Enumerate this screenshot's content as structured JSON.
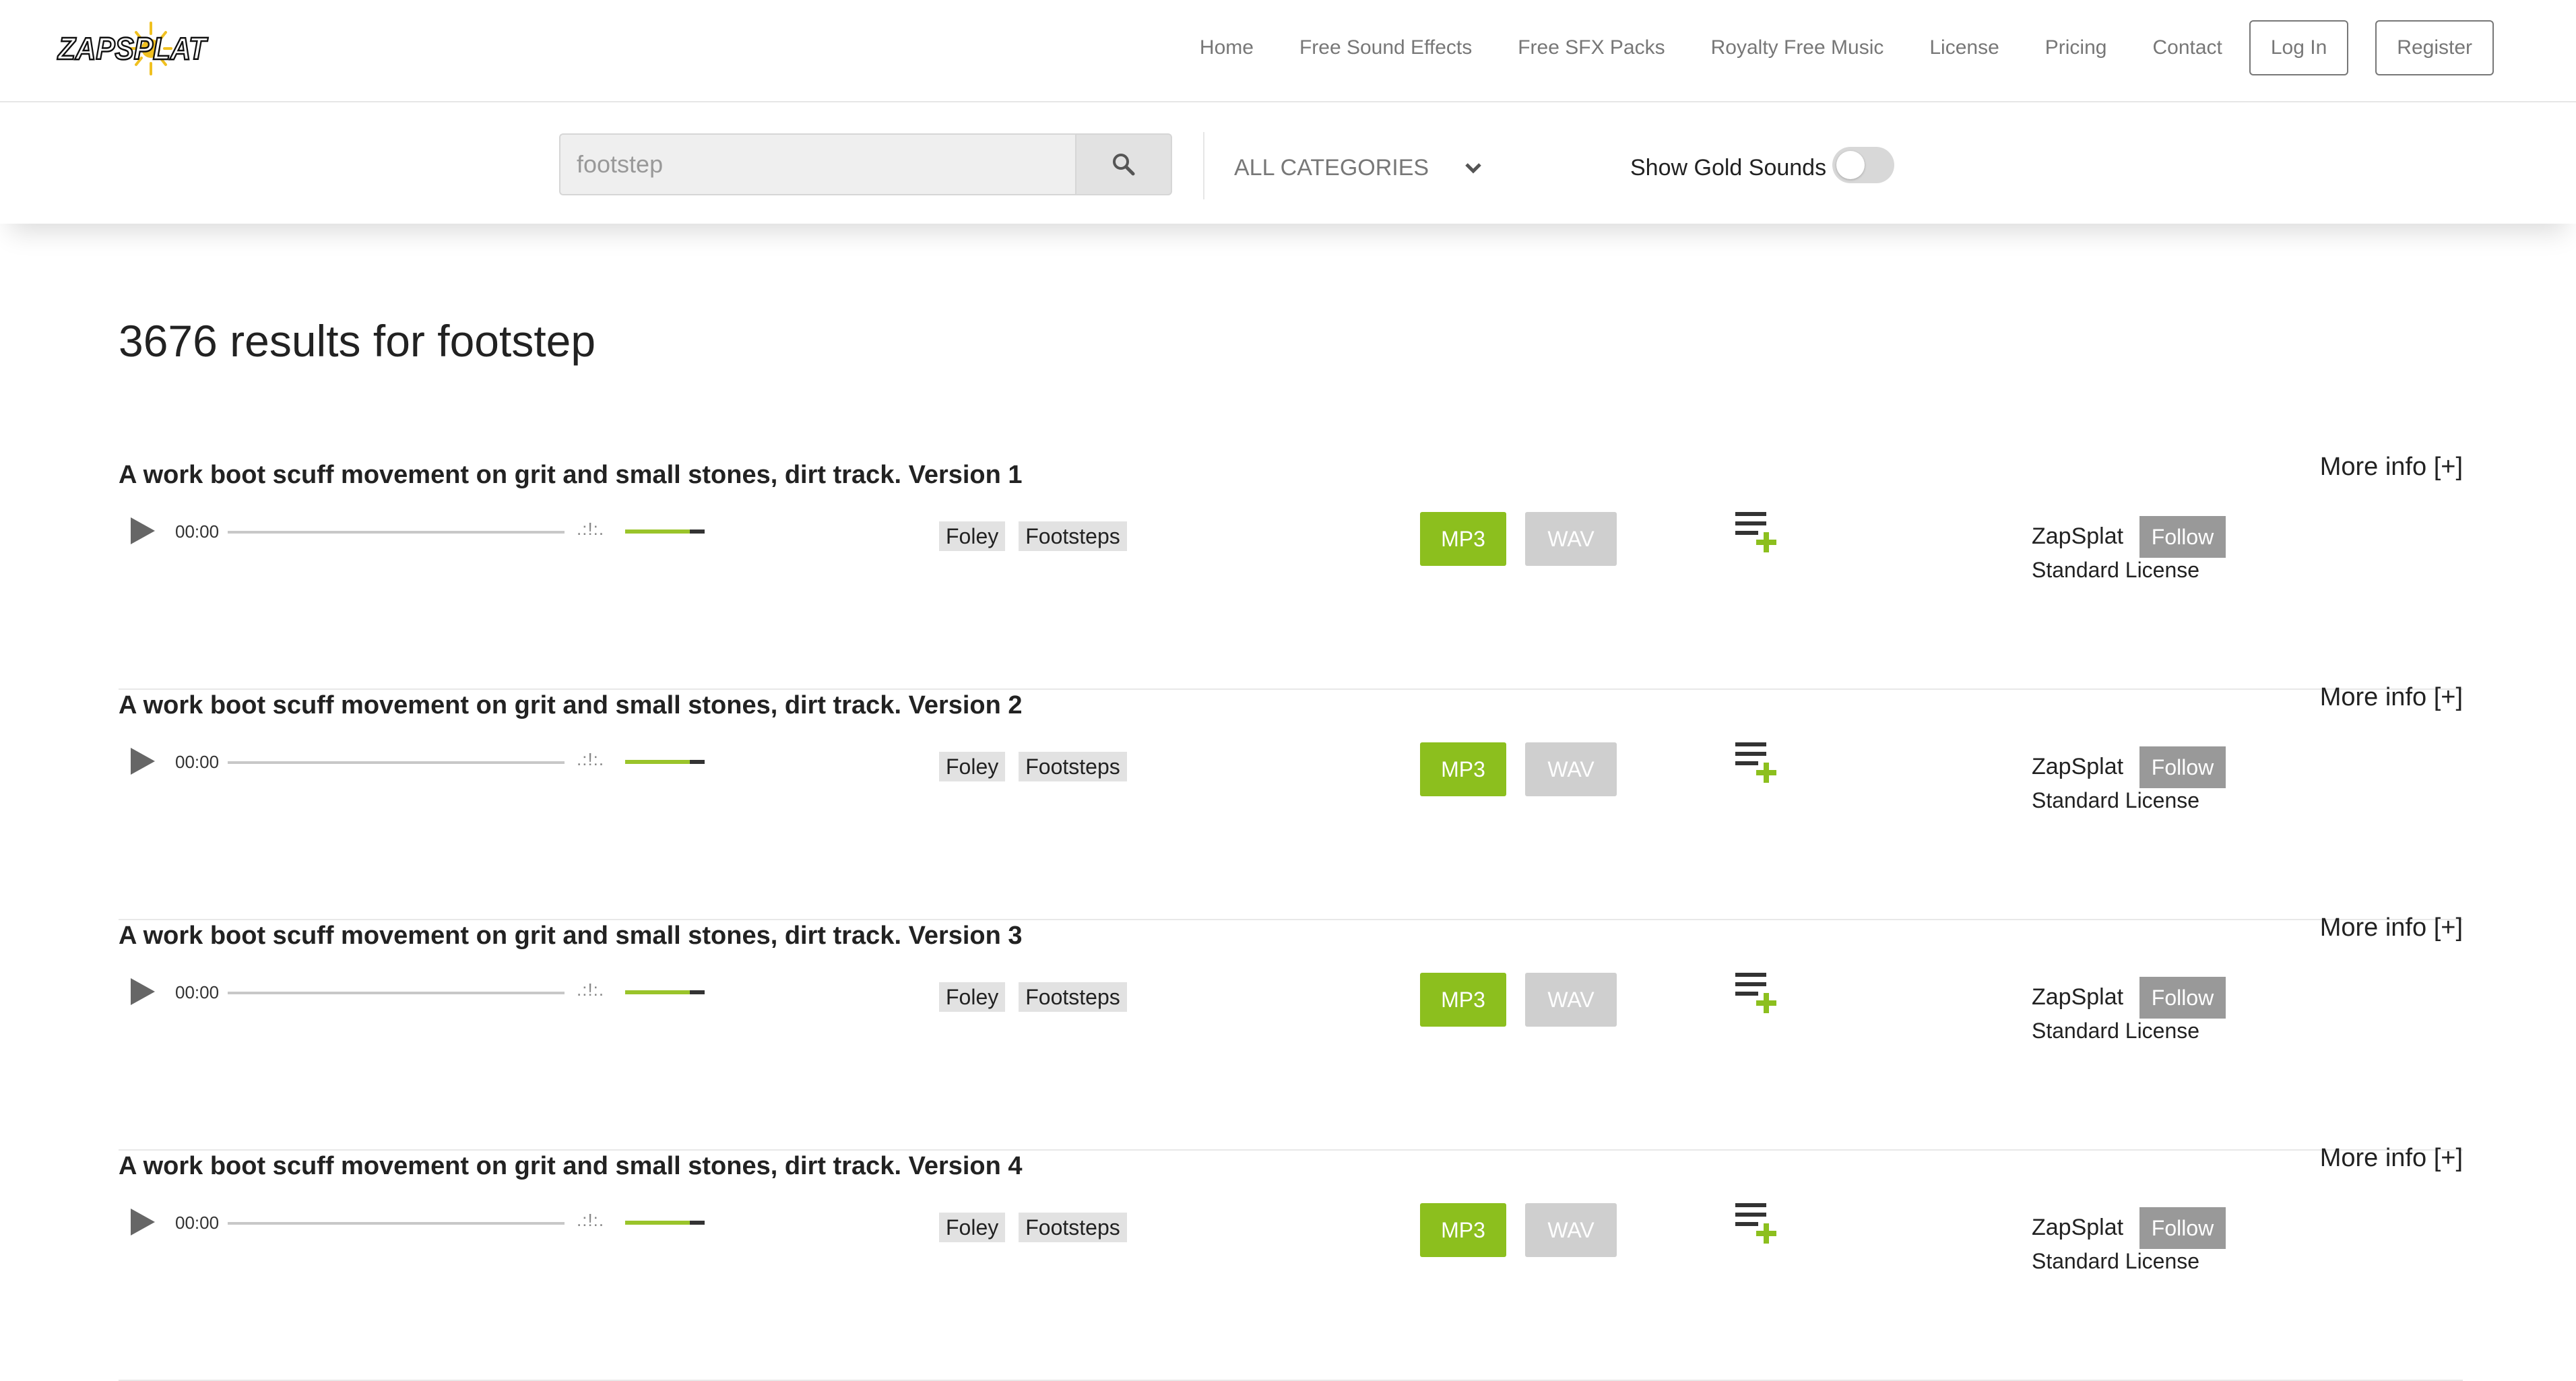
{
  "brand": {
    "logo_text": "ZAPSPLAT",
    "accent": "#8cbf1e",
    "logo_sun": "#f0c020"
  },
  "nav": {
    "links": [
      "Home",
      "Free Sound Effects",
      "Free SFX Packs",
      "Royalty Free Music",
      "License",
      "Pricing",
      "Contact"
    ],
    "login_label": "Log In",
    "register_label": "Register"
  },
  "search": {
    "query": "footstep",
    "button_icon": "search-icon",
    "category": "ALL CATEGORIES",
    "gold_label": "Show Gold Sounds",
    "gold_enabled": false
  },
  "results": {
    "summary": "3676 results for footstep",
    "items": [
      {
        "title": "A work boot scuff movement on grit and small stones, dirt track. Version 1",
        "time": "00:00",
        "tags": [
          "Foley",
          "Footsteps"
        ],
        "mp3": "MP3",
        "wav": "WAV",
        "author": "ZapSplat",
        "follow": "Follow",
        "license": "Standard License",
        "more": "More info [+]"
      },
      {
        "title": "A work boot scuff movement on grit and small stones, dirt track. Version 2",
        "time": "00:00",
        "tags": [
          "Foley",
          "Footsteps"
        ],
        "mp3": "MP3",
        "wav": "WAV",
        "author": "ZapSplat",
        "follow": "Follow",
        "license": "Standard License",
        "more": "More info [+]"
      },
      {
        "title": "A work boot scuff movement on grit and small stones, dirt track. Version 3",
        "time": "00:00",
        "tags": [
          "Foley",
          "Footsteps"
        ],
        "mp3": "MP3",
        "wav": "WAV",
        "author": "ZapSplat",
        "follow": "Follow",
        "license": "Standard License",
        "more": "More info [+]"
      },
      {
        "title": "A work boot scuff movement on grit and small stones, dirt track. Version 4",
        "time": "00:00",
        "tags": [
          "Foley",
          "Footsteps"
        ],
        "mp3": "MP3",
        "wav": "WAV",
        "author": "ZapSplat",
        "follow": "Follow",
        "license": "Standard License",
        "more": "More info [+]"
      }
    ]
  }
}
